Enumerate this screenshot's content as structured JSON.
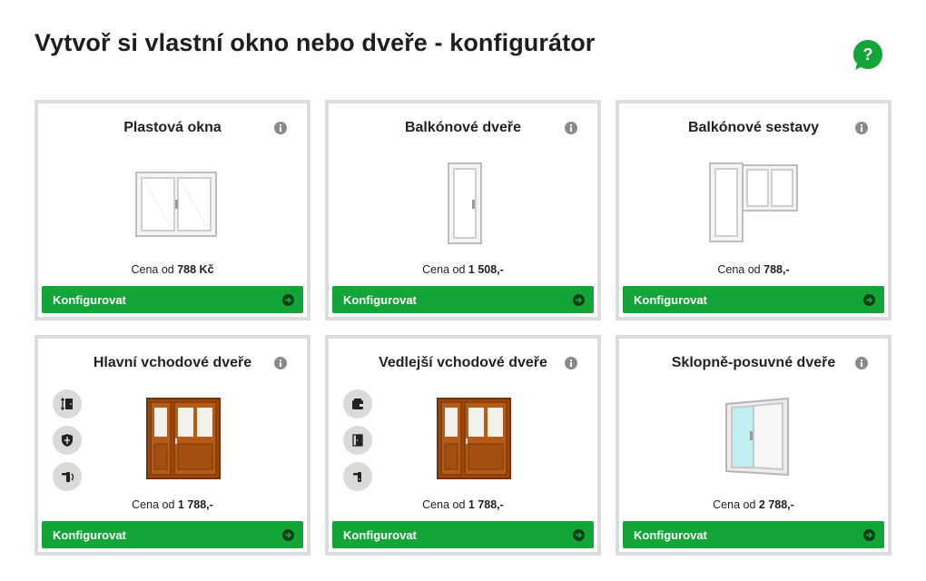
{
  "page": {
    "title": "Vytvoř si vlastní okno nebo dveře - konfigurátor",
    "help_label": "?"
  },
  "colors": {
    "accent_green": "#13a538",
    "card_border": "#dcdcdc",
    "feature_bg": "#dadad6"
  },
  "cards": [
    {
      "title": "Plastová okna",
      "price_prefix": "Cena od",
      "price_value": "788 Kč",
      "button_label": "Konfigurovat",
      "image": "double-window-image"
    },
    {
      "title": "Balkónové dveře",
      "price_prefix": "Cena od",
      "price_value": "1 508,-",
      "button_label": "Konfigurovat",
      "image": "balcony-door-image"
    },
    {
      "title": "Balkónové sestavy",
      "price_prefix": "Cena od",
      "price_value": "788,-",
      "button_label": "Konfigurovat",
      "image": "balcony-set-image"
    },
    {
      "title": "Hlavní vchodové dveře",
      "price_prefix": "Cena od",
      "price_value": "1 788,-",
      "button_label": "Konfigurovat",
      "image": "wooden-entrance-door-image",
      "feature_icons": [
        "door-dimensions-icon",
        "security-shield-icon",
        "door-handle-lock-icon"
      ]
    },
    {
      "title": "Vedlejší vchodové dveře",
      "price_prefix": "Cena od",
      "price_value": "1 788,-",
      "button_label": "Konfigurovat",
      "image": "wooden-side-door-image",
      "feature_icons": [
        "wallet-icon",
        "door-icon",
        "door-handle-icon"
      ]
    },
    {
      "title": "Sklopně-posuvné dveře",
      "price_prefix": "Cena od",
      "price_value": "2 788,-",
      "button_label": "Konfigurovat",
      "image": "sliding-door-image"
    }
  ]
}
